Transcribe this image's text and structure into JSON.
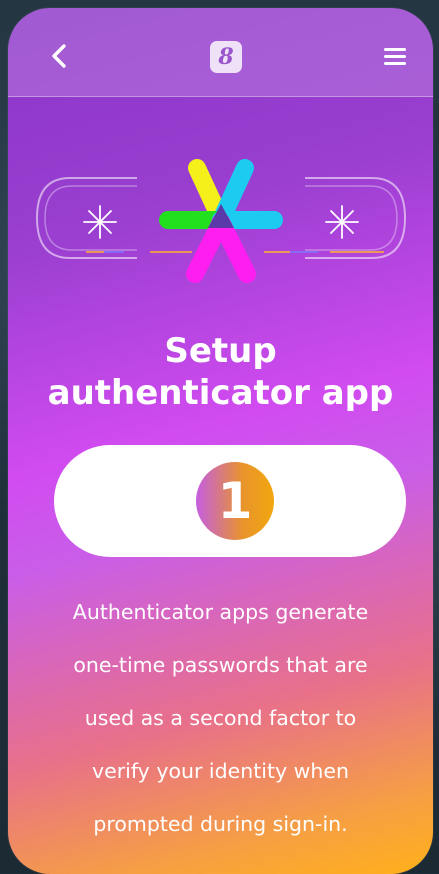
{
  "header": {
    "back_icon": "chevron-left-icon",
    "logo_text": "8",
    "menu_icon": "hamburger-menu-icon"
  },
  "hero": {
    "left_glyph": "*",
    "right_glyph": "*"
  },
  "page": {
    "title_line1": "Setup",
    "title_line2": "authenticator app",
    "step_number": "1",
    "description_lines": [
      "Authenticator apps generate",
      "one-time passwords that are",
      "used as a second factor to",
      "verify your identity when",
      "prompted during sign-in."
    ]
  },
  "colors": {
    "gradient_top": "#8a35c8",
    "gradient_mid": "#d14bf0",
    "gradient_bottom": "#ffb01a",
    "logo_yellow": "#f5ef1a",
    "logo_cyan": "#1ecbf0",
    "logo_green": "#22e01e",
    "logo_magenta": "#ff1ef0",
    "logo_center": "#5a3aa8"
  }
}
